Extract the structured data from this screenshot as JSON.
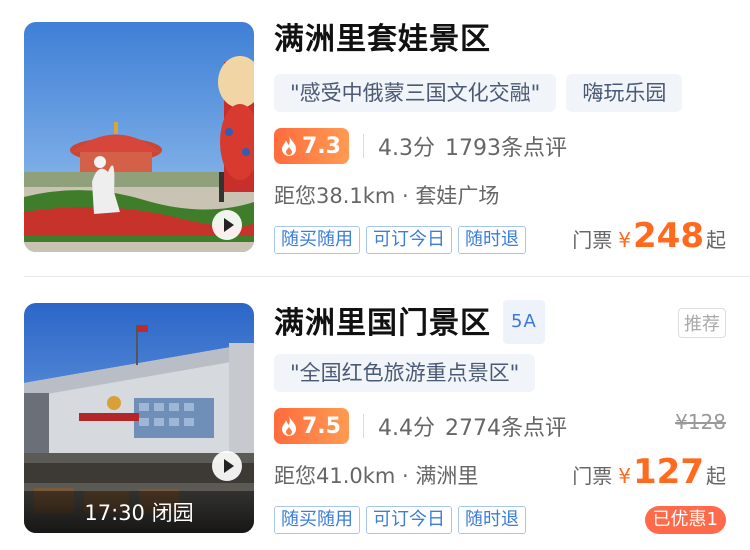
{
  "listings": [
    {
      "title": "满洲里套娃景区",
      "tags": [
        "\"感受中俄蒙三国文化交融\"",
        "嗨玩乐园"
      ],
      "hot_score": "7.3",
      "rating": "4.3分",
      "reviews": "1793条点评",
      "distance": "距您38.1km · 套娃广场",
      "chips": [
        "随买随用",
        "可订今日",
        "随时退"
      ],
      "price_label": "门票",
      "currency": "¥",
      "price": "248",
      "price_suffix": "起"
    },
    {
      "title": "满洲里国门景区",
      "grade": "5A",
      "recommend": "推荐",
      "tags": [
        "\"全国红色旅游重点景区\""
      ],
      "hot_score": "7.5",
      "rating": "4.4分",
      "reviews": "2774条点评",
      "distance": "距您41.0km · 满洲里",
      "chips": [
        "随买随用",
        "可订今日",
        "随时退"
      ],
      "original_price": "¥128",
      "price_label": "门票",
      "currency": "¥",
      "price": "127",
      "price_suffix": "起",
      "closing": "17:30 闭园",
      "discount": "已优惠1"
    }
  ],
  "colors": {
    "accent_price": "#ff6a1f",
    "hot_gradient_start": "#ff6b3d",
    "chip_blue": "#3b7ddd"
  },
  "icons": {
    "hot": "flame-icon",
    "play": "play-icon"
  }
}
